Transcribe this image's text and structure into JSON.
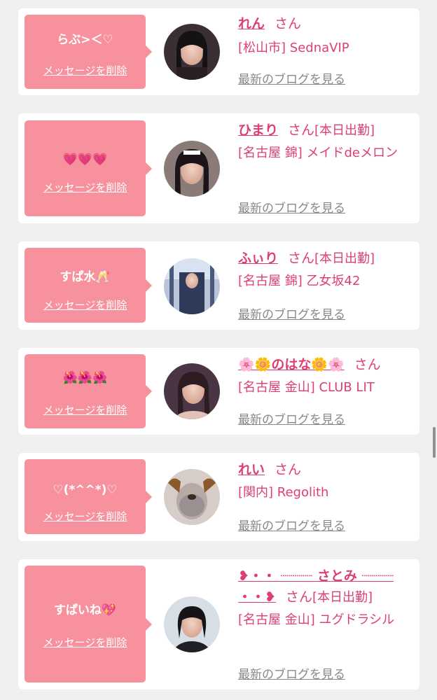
{
  "colors": {
    "background": "#efefef",
    "card": "#ffffff",
    "bubble": "#f8919e",
    "accent": "#de3f73",
    "link_gray": "#888888"
  },
  "delete_label": "メッセージを削除",
  "san_label": "さん",
  "blog_label": "最新のブログを見る",
  "messages": [
    {
      "message": "らぶ>＜♡",
      "name": "れん",
      "attendance": "",
      "shop": "[松山市] SednaVIP",
      "avatar_icon": "girl-photo-icon"
    },
    {
      "message": "💗💗💗",
      "name": "ひまり",
      "attendance": "[本日出勤]",
      "shop": "[名古屋 錦] メイドdeメロン",
      "avatar_icon": "girl-photo-icon"
    },
    {
      "message": "すぱ水🥂",
      "name": "ふぃり",
      "attendance": "[本日出勤]",
      "shop": "[名古屋 錦] 乙女坂42",
      "avatar_icon": "girl-photo-icon"
    },
    {
      "message": "🌺🌺🌺",
      "name": "🌸🌼のはな🌼🌸",
      "attendance": "",
      "shop": "[名古屋 金山] CLUB LIT",
      "avatar_icon": "girl-photo-icon"
    },
    {
      "message": "♡(*^^*)♡",
      "name": "れい",
      "attendance": "",
      "shop": "[関内] Regolith",
      "avatar_icon": "girl-photo-icon"
    },
    {
      "message": "すぱいね💖",
      "name_line1": "❥・・ ┈┈┈┈ さとみ ┈┈┈┈",
      "name_line2": "・・❥",
      "attendance": "[本日出勤]",
      "shop": "[名古屋 金山] ユグドラシル",
      "avatar_icon": "girl-photo-icon"
    }
  ]
}
